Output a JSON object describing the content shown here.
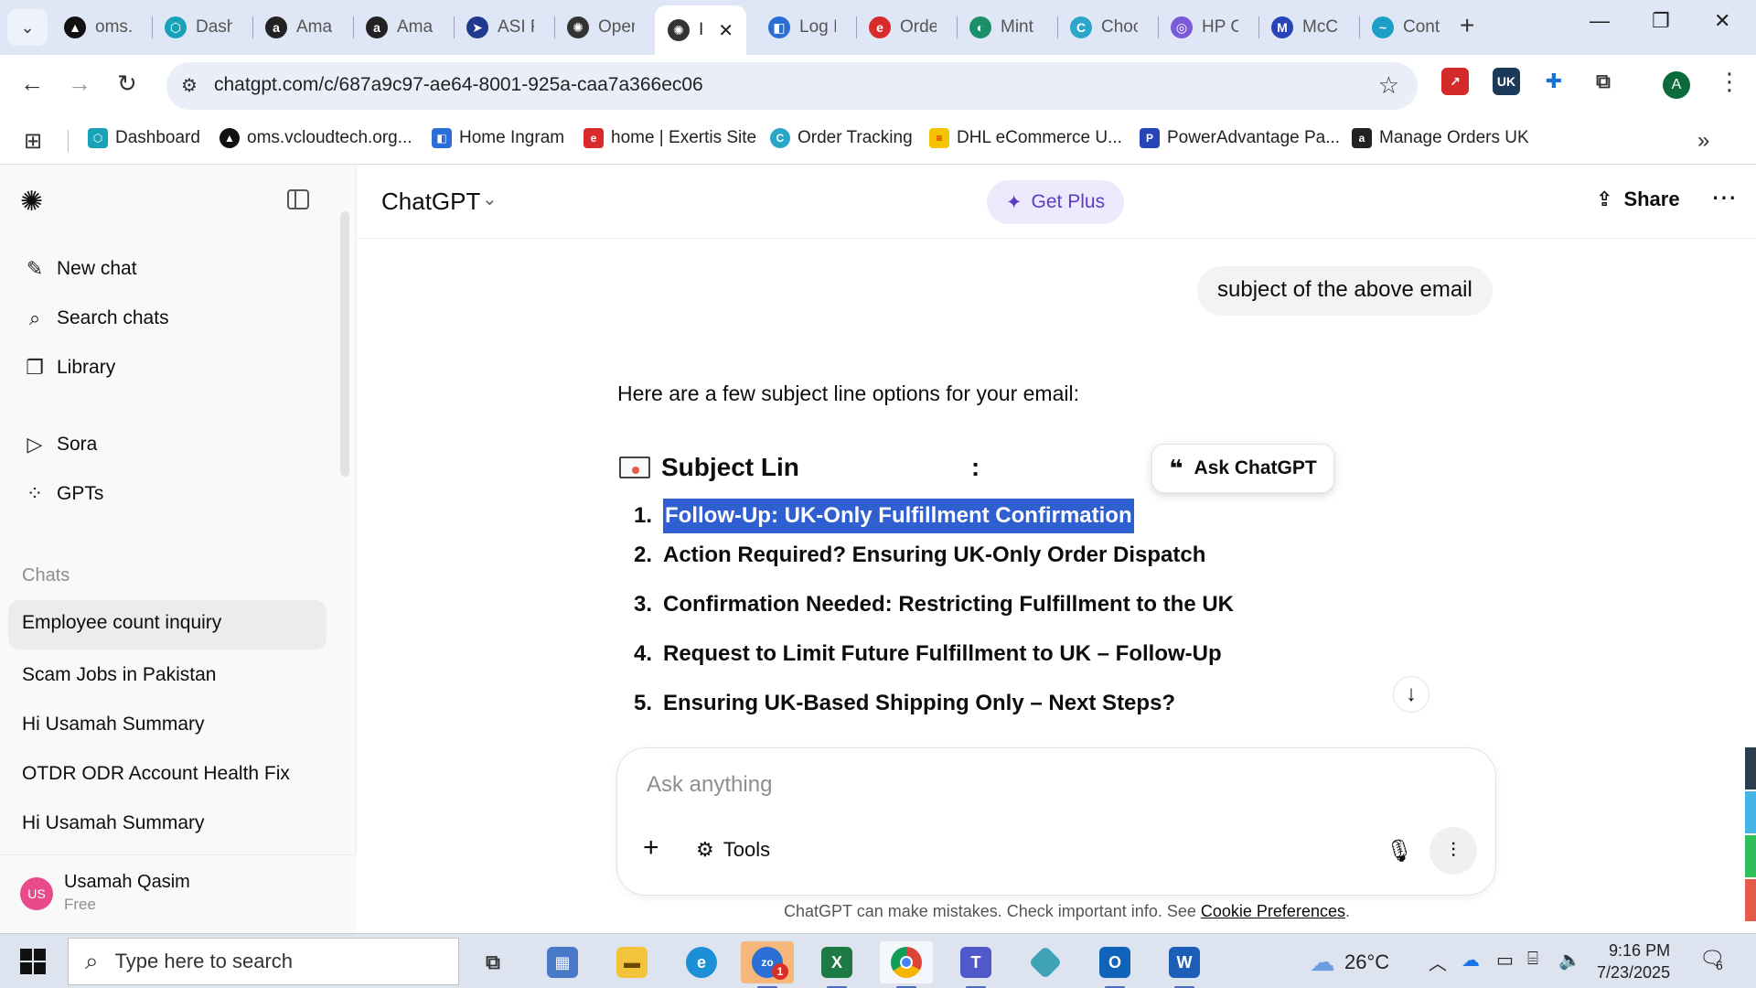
{
  "browser": {
    "tabs": [
      {
        "title": "oms.",
        "fav_bg": "#111111",
        "fav_glyph": "▲"
      },
      {
        "title": "Dash",
        "fav_bg": "#17a2b8",
        "fav_glyph": "⬡"
      },
      {
        "title": "Ama:",
        "fav_bg": "#222222",
        "fav_glyph": "a"
      },
      {
        "title": "Ama:",
        "fav_bg": "#222222",
        "fav_glyph": "a"
      },
      {
        "title": "ASI F",
        "fav_bg": "#1f3b8f",
        "fav_glyph": "➤"
      },
      {
        "title": "Oper",
        "fav_bg": "#333333",
        "fav_glyph": "✺"
      },
      {
        "title": "I",
        "fav_bg": "#333333",
        "fav_glyph": "✺",
        "active": true
      },
      {
        "title": "Log I",
        "fav_bg": "#2b6fd6",
        "fav_glyph": "◧"
      },
      {
        "title": "Orde",
        "fav_bg": "#d92b2b",
        "fav_glyph": "e"
      },
      {
        "title": "Mint",
        "fav_bg": "#1b8f6a",
        "fav_glyph": "◐"
      },
      {
        "title": "Choc",
        "fav_bg": "#2aa6c9",
        "fav_glyph": "C"
      },
      {
        "title": "HP C",
        "fav_bg": "#7a5ad6",
        "fav_glyph": "◎"
      },
      {
        "title": "McC",
        "fav_bg": "#2744b8",
        "fav_glyph": "M"
      },
      {
        "title": "Cont",
        "fav_bg": "#1aa0c6",
        "fav_glyph": "~"
      }
    ],
    "url": "chatgpt.com/c/687a9c97-ae64-8001-925a-caa7a366ec06",
    "bookmarks": [
      {
        "label": "Dashboard",
        "fav_bg": "#17a2b8",
        "fav_glyph": "⬡"
      },
      {
        "label": "oms.vcloudtech.org...",
        "fav_bg": "#111111",
        "fav_glyph": "▲"
      },
      {
        "label": "Home Ingram",
        "fav_bg": "#2b6fd6",
        "fav_glyph": "◧"
      },
      {
        "label": "home | Exertis Site",
        "fav_bg": "#d92b2b",
        "fav_glyph": "e"
      },
      {
        "label": "Order Tracking",
        "fav_bg": "#2aa6c9",
        "fav_glyph": "C"
      },
      {
        "label": "DHL eCommerce U...",
        "fav_bg": "#f5c400",
        "fav_glyph": "≡"
      },
      {
        "label": "PowerAdvantage Pa...",
        "fav_bg": "#2744b8",
        "fav_glyph": "P"
      },
      {
        "label": "Manage Orders UK",
        "fav_bg": "#222222",
        "fav_glyph": "a"
      }
    ],
    "profile_initial": "A"
  },
  "sidebar": {
    "nav": [
      {
        "label": "New chat",
        "icon": "new-chat-icon"
      },
      {
        "label": "Search chats",
        "icon": "search-icon"
      },
      {
        "label": "Library",
        "icon": "library-icon"
      },
      {
        "label": "Sora",
        "icon": "sora-icon"
      },
      {
        "label": "GPTs",
        "icon": "gpts-icon"
      }
    ],
    "section_label": "Chats",
    "chats": [
      "Employee count inquiry",
      "Scam Jobs in Pakistan",
      "Hi Usamah Summary",
      "OTDR ODR Account Health Fix",
      "Hi Usamah Summary"
    ],
    "user": {
      "initials": "US",
      "name": "Usamah Qasim",
      "plan": "Free"
    }
  },
  "main": {
    "model": "ChatGPT",
    "get_plus": "Get Plus",
    "share": "Share",
    "user_message": "subject of the above email",
    "assistant_intro": "Here are a few subject line options for your email:",
    "heading_visible": "Subject Lin",
    "heading_tail": ":",
    "ask_chip": "Ask ChatGPT",
    "options": [
      "Follow-Up: UK-Only Fulfillment Confirmation",
      "Action Required? Ensuring UK-Only Order Dispatch",
      "Confirmation Needed: Restricting Fulfillment to the UK",
      "Request to Limit Future Fulfillment to UK – Follow-Up",
      "Ensuring UK-Based Shipping Only – Next Steps?"
    ],
    "option_numbers": [
      "1.",
      "2.",
      "3.",
      "4.",
      "5."
    ],
    "composer_placeholder": "Ask anything",
    "tools_label": "Tools",
    "disclaimer": "ChatGPT can make mistakes. Check important info. See",
    "disclaimer_link": "Cookie Preferences",
    "disclaimer_end": "."
  },
  "taskbar": {
    "search_placeholder": "Type here to search",
    "weather": "26°C",
    "time": "9:16 PM",
    "date": "7/23/2025",
    "notifications": "6",
    "zoom_badge": "1"
  }
}
